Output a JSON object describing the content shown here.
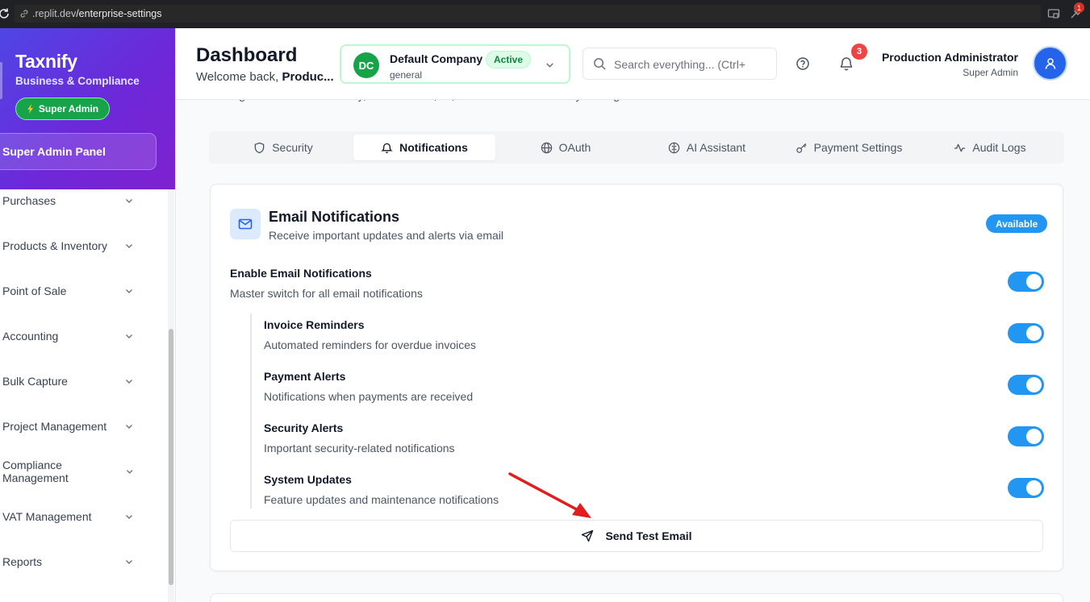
{
  "browser": {
    "url_host": ".replit.dev",
    "url_path": "/enterprise-settings",
    "extension_badge": "1"
  },
  "sidebar": {
    "brand_title": "Taxnify",
    "brand_subtitle": "Business & Compliance",
    "role_pill": "Super Admin",
    "admin_panel": "Super Admin Panel",
    "items": [
      {
        "label": "Purchases"
      },
      {
        "label": "Products & Inventory"
      },
      {
        "label": "Point of Sale"
      },
      {
        "label": "Accounting"
      },
      {
        "label": "Bulk Capture"
      },
      {
        "label": "Project Management"
      },
      {
        "label": "Compliance Management"
      },
      {
        "label": "VAT Management"
      },
      {
        "label": "Reports"
      }
    ]
  },
  "header": {
    "title": "Dashboard",
    "welcome_prefix": "Welcome back, ",
    "welcome_name": "Produc...",
    "company": {
      "initials": "DC",
      "name": "Default Company",
      "status": "Active",
      "type": "general"
    },
    "search_placeholder": "Search everything... (Ctrl+",
    "notification_count": "3",
    "user_name": "Production Administrator",
    "user_role": "Super Admin"
  },
  "main": {
    "subtitle": "Configure advanced security, notifications, AI, and audit features for your organization",
    "tabs": [
      {
        "label": "Security",
        "icon": "shield-icon",
        "active": false
      },
      {
        "label": "Notifications",
        "icon": "bell-icon",
        "active": true
      },
      {
        "label": "OAuth",
        "icon": "globe-icon",
        "active": false
      },
      {
        "label": "AI Assistant",
        "icon": "brain-icon",
        "active": false
      },
      {
        "label": "Payment Settings",
        "icon": "key-icon",
        "active": false
      },
      {
        "label": "Audit Logs",
        "icon": "activity-icon",
        "active": false
      }
    ],
    "email_card": {
      "title": "Email Notifications",
      "description": "Receive important updates and alerts via email",
      "badge": "Available",
      "master": {
        "label": "Enable Email Notifications",
        "description": "Master switch for all email notifications",
        "enabled": true
      },
      "settings": [
        {
          "label": "Invoice Reminders",
          "description": "Automated reminders for overdue invoices",
          "enabled": true
        },
        {
          "label": "Payment Alerts",
          "description": "Notifications when payments are received",
          "enabled": true
        },
        {
          "label": "Security Alerts",
          "description": "Important security-related notifications",
          "enabled": true
        },
        {
          "label": "System Updates",
          "description": "Feature updates and maintenance notifications",
          "enabled": true
        }
      ],
      "test_button": "Send Test Email"
    }
  },
  "colors": {
    "accent": "#2196f3",
    "brand_gradient_start": "#4f46e5",
    "brand_gradient_end": "#7e22ce",
    "success": "#16a34a",
    "danger": "#ef4444",
    "annotation_arrow": "#e11d1d"
  }
}
